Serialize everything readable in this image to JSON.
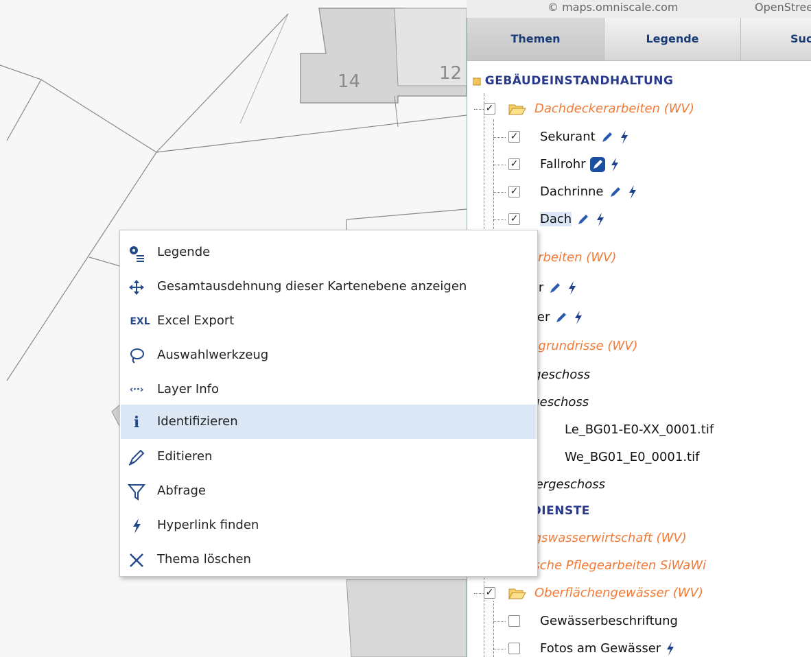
{
  "attribution": {
    "provider": "© maps.omniscale.com",
    "other": "OpenStreetMap"
  },
  "map": {
    "parcel_numbers": [
      "14",
      "12"
    ]
  },
  "tabs": [
    {
      "label": "Themen",
      "active": true
    },
    {
      "label": "Legende",
      "active": false
    },
    {
      "label": "Suche",
      "active": false
    }
  ],
  "tree": {
    "group1": "Gebäudeinstandhaltung",
    "group2": "Grunddienste",
    "rows": [
      {
        "label": "Dachdeckerarbeiten (WV)",
        "checked": true
      },
      {
        "label": "Sekurant",
        "checked": true
      },
      {
        "label": "Fallrohr",
        "checked": true
      },
      {
        "label": "Dachrinne",
        "checked": true
      },
      {
        "label": "Dach",
        "checked": true
      },
      {
        "label": "Malerarbeiten (WV)"
      },
      {
        "label": "Tür"
      },
      {
        "label": "Geländer"
      },
      {
        "label": "Gebäudegrundrisse (WV)"
      },
      {
        "label": "Untergeschoss"
      },
      {
        "label": "Erdgeschoss"
      },
      {
        "label": "Le_BG01-E0-XX_0001.tif"
      },
      {
        "label": "We_BG01_E0_0001.tif"
      },
      {
        "label": "Obergeschoss"
      },
      {
        "label": "Siedlungswasserwirtschaft (WV)"
      },
      {
        "label": "Gärtnerische Pflegearbeiten SiWaWi"
      },
      {
        "label": "Oberflächengewässer (WV)",
        "checked": true
      },
      {
        "label": "Gewässerbeschriftung",
        "checked": false
      },
      {
        "label": "Fotos am Gewässer",
        "checked": false
      }
    ]
  },
  "context_menu": {
    "items": [
      {
        "label": "Legende",
        "icon": "legend-icon"
      },
      {
        "label": "Gesamtausdehnung dieser Kartenebene anzeigen",
        "icon": "move-arrows-icon"
      },
      {
        "label": "Excel Export",
        "icon": "excel-icon",
        "icon_text": "EXL"
      },
      {
        "label": "Auswahlwerkzeug",
        "icon": "lasso-icon"
      },
      {
        "label": "Layer Info",
        "icon": "layer-info-icon",
        "icon_text": "‹··›"
      },
      {
        "label": "Identifizieren",
        "icon": "info-icon",
        "icon_text": "i",
        "highlighted": true
      },
      {
        "label": "Editieren",
        "icon": "edit-pencil-icon"
      },
      {
        "label": "Abfrage",
        "icon": "filter-icon"
      },
      {
        "label": "Hyperlink finden",
        "icon": "lightning-icon"
      },
      {
        "label": "Thema löschen",
        "icon": "close-x-icon"
      }
    ]
  },
  "colors": {
    "group_title": "#2a3a8a",
    "orange_folder_label": "#f07a36",
    "menu_highlight": "#dce7f6",
    "icon_blue": "#24488c"
  }
}
